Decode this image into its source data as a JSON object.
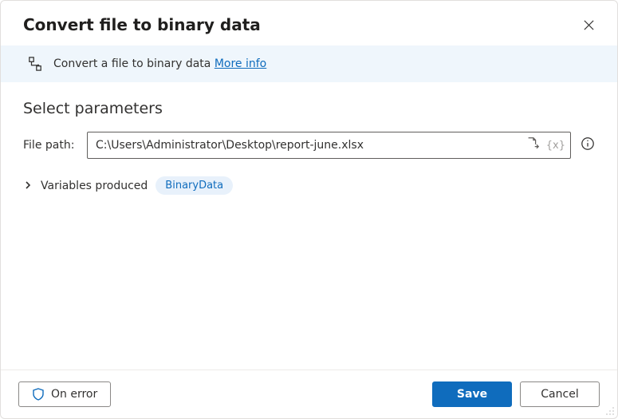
{
  "dialog": {
    "title": "Convert file to binary data"
  },
  "banner": {
    "text": "Convert a file to binary data ",
    "more_link": "More info"
  },
  "section": {
    "title": "Select parameters"
  },
  "param": {
    "file_path_label": "File path:",
    "file_path_value": "C:\\Users\\Administrator\\Desktop\\report-june.xlsx",
    "variable_token": "{x}"
  },
  "variables": {
    "label": "Variables produced",
    "chip": "BinaryData"
  },
  "footer": {
    "on_error": "On error",
    "save": "Save",
    "cancel": "Cancel"
  }
}
